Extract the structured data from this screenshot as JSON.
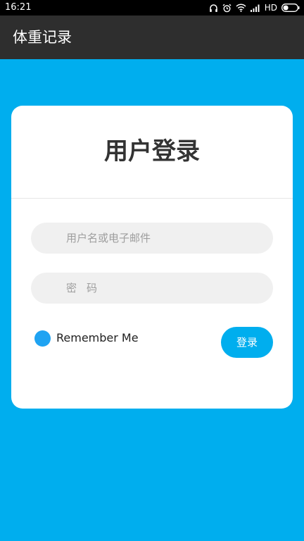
{
  "status_bar": {
    "time": "16:21",
    "network_label": "HD",
    "icons": [
      "headphones-icon",
      "alarm-icon",
      "wifi-icon",
      "signal-icon",
      "battery-icon"
    ]
  },
  "app_bar": {
    "title": "体重记录"
  },
  "login": {
    "title": "用户登录",
    "username_placeholder": "用户名或电子邮件",
    "password_placeholder": "密码",
    "remember_label": "Remember Me",
    "button_label": "登录"
  },
  "colors": {
    "background": "#00AEEE",
    "app_bar": "#2E2E2E",
    "card": "#FFFFFF",
    "input_bg": "#F0F0F0",
    "checkbox": "#1FA3F2",
    "button": "#00AEEE"
  }
}
